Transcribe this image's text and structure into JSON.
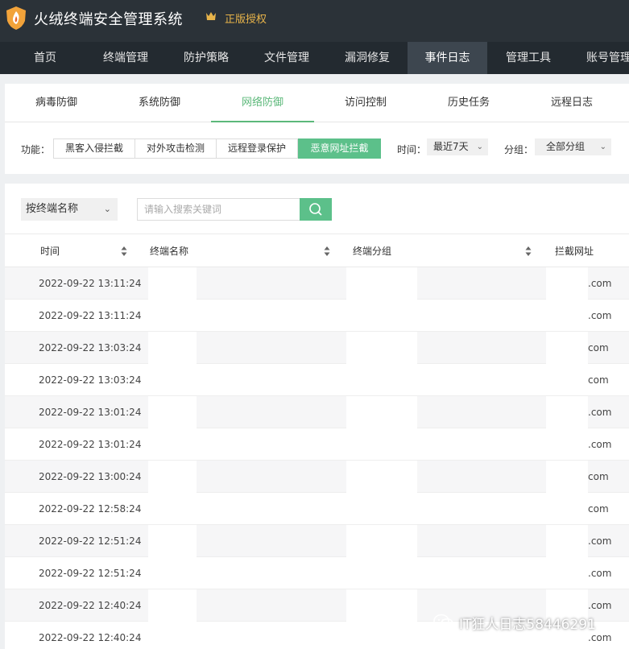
{
  "header": {
    "app_title": "火绒终端安全管理系统",
    "license": "正版授权",
    "logo_icon": "flame-shield-icon",
    "license_icon": "crown-icon",
    "brand_color": "#2b3238"
  },
  "nav": {
    "items": [
      {
        "label": "首页"
      },
      {
        "label": "终端管理"
      },
      {
        "label": "防护策略"
      },
      {
        "label": "文件管理"
      },
      {
        "label": "漏洞修复"
      },
      {
        "label": "事件日志"
      },
      {
        "label": "管理工具"
      },
      {
        "label": "账号管理"
      }
    ],
    "active_index": 5
  },
  "subtabs": {
    "items": [
      {
        "label": "病毒防御"
      },
      {
        "label": "系统防御"
      },
      {
        "label": "网络防御"
      },
      {
        "label": "访问控制"
      },
      {
        "label": "历史任务"
      },
      {
        "label": "远程日志"
      }
    ],
    "active_index": 2,
    "accent": "#5cb87a"
  },
  "filters": {
    "function_label": "功能：",
    "buttons": [
      {
        "label": "黑客入侵拦截"
      },
      {
        "label": "对外攻击检测"
      },
      {
        "label": "远程登录保护"
      },
      {
        "label": "恶意网址拦截"
      }
    ],
    "active_button": 3,
    "time_label": "时间：",
    "time_value": "最近7天",
    "group_label": "分组：",
    "group_value": "全部分组"
  },
  "search": {
    "scope_value": "按终端名称",
    "placeholder": "请输入搜索关键词",
    "button_icon": "search-icon"
  },
  "table": {
    "columns": [
      "时间",
      "终端名称",
      "终端分组",
      "拦截网址"
    ],
    "rows": [
      {
        "time": "2022-09-22 13:11:24",
        "url": ".com"
      },
      {
        "time": "2022-09-22 13:11:24",
        "url": ".com"
      },
      {
        "time": "2022-09-22 13:03:24",
        "url": "com"
      },
      {
        "time": "2022-09-22 13:03:24",
        "url": "com"
      },
      {
        "time": "2022-09-22 13:01:24",
        "url": ".com"
      },
      {
        "time": "2022-09-22 13:01:24",
        "url": ".com"
      },
      {
        "time": "2022-09-22 13:00:24",
        "url": "com"
      },
      {
        "time": "2022-09-22 12:58:24",
        "url": "com"
      },
      {
        "time": "2022-09-22 12:51:24",
        "url": ".com"
      },
      {
        "time": "2022-09-22 12:51:24",
        "url": ".com"
      },
      {
        "time": "2022-09-22 12:40:24",
        "url": ".com"
      },
      {
        "time": "2022-09-22 12:40:24",
        "url": ".com"
      }
    ]
  },
  "watermark": {
    "text": "IT狂人日志58446291",
    "icon": "wechat-icon"
  }
}
